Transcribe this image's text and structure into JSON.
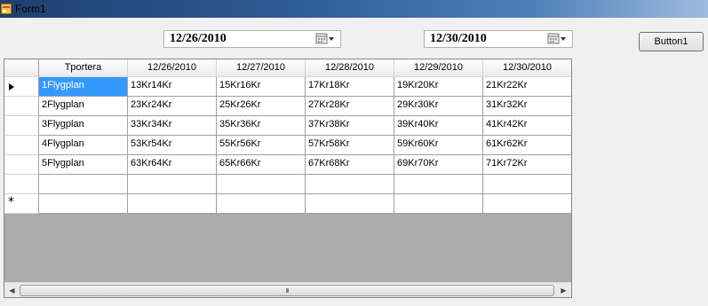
{
  "window": {
    "title": "Form1"
  },
  "date_picker_1": {
    "value": "12/26/2010"
  },
  "date_picker_2": {
    "value": "12/30/2010"
  },
  "button1": {
    "label": "Button1"
  },
  "grid": {
    "columns": [
      "Tportera",
      "12/26/2010",
      "12/27/2010",
      "12/28/2010",
      "12/29/2010",
      "12/30/2010"
    ],
    "rows": [
      [
        "1Flygplan",
        "13Kr14Kr",
        "15Kr16Kr",
        "17Kr18Kr",
        "19Kr20Kr",
        "21Kr22Kr"
      ],
      [
        "2Flygplan",
        "23Kr24Kr",
        "25Kr26Kr",
        "27Kr28Kr",
        "29Kr30Kr",
        "31Kr32Kr"
      ],
      [
        "3Flygplan",
        "33Kr34Kr",
        "35Kr36Kr",
        "37Kr38Kr",
        "39Kr40Kr",
        "41Kr42Kr"
      ],
      [
        "4Flygplan",
        "53Kr54Kr",
        "55Kr56Kr",
        "57Kr58Kr",
        "59Kr60Kr",
        "61Kr62Kr"
      ],
      [
        "5Flygplan",
        "63Kr64Kr",
        "65Kr66Kr",
        "67Kr68Kr",
        "69Kr70Kr",
        "71Kr72Kr"
      ],
      [
        "",
        "",
        "",
        "",
        "",
        ""
      ]
    ],
    "selected_row": 0,
    "selected_col": 0,
    "current_row_marker": "current-row-arrow-icon",
    "new_row_marker": "new-row-asterisk-icon",
    "new_row_glyph": "*"
  },
  "hscroll": {
    "thumb_grip": "III"
  },
  "colors": {
    "selection": "#3399ff",
    "grid_bg": "#ababab"
  }
}
